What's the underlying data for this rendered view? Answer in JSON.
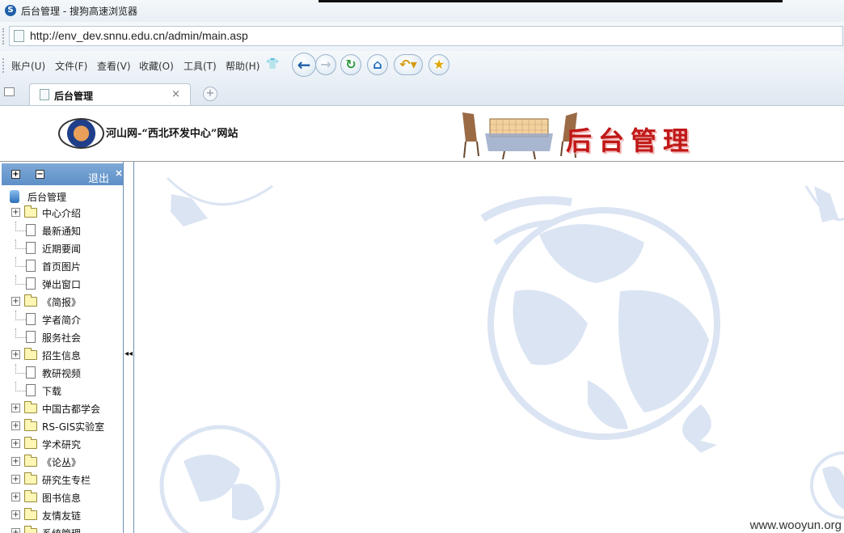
{
  "window": {
    "title": "后台管理 - 搜狗高速浏览器"
  },
  "address": {
    "url": "http://env_dev.snnu.edu.cn/admin/main.asp"
  },
  "menu": {
    "items": [
      "账户(U)",
      "文件(F)",
      "查看(V)",
      "收藏(O)",
      "工具(T)",
      "帮助(H)"
    ]
  },
  "tabs": [
    {
      "title": "后台管理",
      "close": "×"
    }
  ],
  "banner": {
    "site_name": "河山网-“西北环发中心”网站",
    "big_title": "后台管理"
  },
  "sidebar": {
    "expand_all": "+",
    "collapse_all": "−",
    "logout_label": "退出",
    "close_label": "×",
    "root_label": "后台管理",
    "items": [
      {
        "label": "中心介绍",
        "type": "folder"
      },
      {
        "label": "最新通知",
        "type": "doc"
      },
      {
        "label": "近期要闻",
        "type": "doc"
      },
      {
        "label": "首页图片",
        "type": "doc"
      },
      {
        "label": "弹出窗口",
        "type": "doc"
      },
      {
        "label": "《简报》",
        "type": "folder"
      },
      {
        "label": "学者简介",
        "type": "doc"
      },
      {
        "label": "服务社会",
        "type": "doc"
      },
      {
        "label": "招生信息",
        "type": "folder"
      },
      {
        "label": "教研视频",
        "type": "doc"
      },
      {
        "label": "下载",
        "type": "doc"
      },
      {
        "label": "中国古都学会",
        "type": "folder"
      },
      {
        "label": "RS-GIS实验室",
        "type": "folder"
      },
      {
        "label": "学术研究",
        "type": "folder"
      },
      {
        "label": "《论丛》",
        "type": "folder"
      },
      {
        "label": "研究生专栏",
        "type": "folder"
      },
      {
        "label": "图书信息",
        "type": "folder"
      },
      {
        "label": "友情友链",
        "type": "folder"
      },
      {
        "label": "系统管理",
        "type": "folder"
      }
    ]
  },
  "splitter": {
    "arrow": "◂◂"
  },
  "watermark": "www.wooyun.org",
  "colors": {
    "sidebar_header": "#6d9bd0",
    "title_red": "#c01818",
    "globe": "#dbe4f3"
  }
}
